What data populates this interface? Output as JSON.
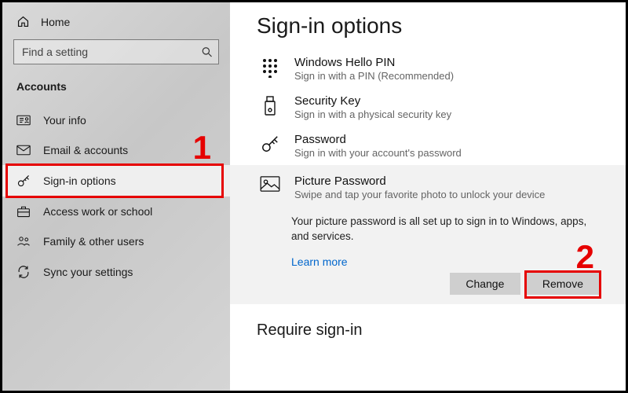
{
  "sidebar": {
    "home": "Home",
    "search_placeholder": "Find a setting",
    "section": "Accounts",
    "items": [
      {
        "label": "Your info"
      },
      {
        "label": "Email & accounts"
      },
      {
        "label": "Sign-in options"
      },
      {
        "label": "Access work or school"
      },
      {
        "label": "Family & other users"
      },
      {
        "label": "Sync your settings"
      }
    ]
  },
  "main": {
    "title": "Sign-in options",
    "options": [
      {
        "title": "Windows Hello PIN",
        "sub": "Sign in with a PIN (Recommended)"
      },
      {
        "title": "Security Key",
        "sub": "Sign in with a physical security key"
      },
      {
        "title": "Password",
        "sub": "Sign in with your account's password"
      },
      {
        "title": "Picture Password",
        "sub": "Swipe and tap your favorite photo to unlock your device"
      }
    ],
    "picture_panel": {
      "text": "Your picture password is all set up to sign in to Windows, apps, and services.",
      "learn_more": "Learn more",
      "change": "Change",
      "remove": "Remove"
    },
    "require_title": "Require sign-in"
  },
  "annotations": {
    "one": "1",
    "two": "2"
  }
}
